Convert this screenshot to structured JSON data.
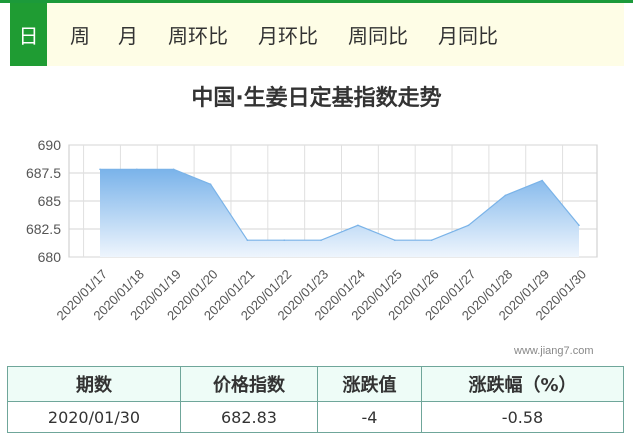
{
  "tabs": [
    {
      "label": "日",
      "active": true
    },
    {
      "label": "周",
      "active": false
    },
    {
      "label": "月",
      "active": false
    },
    {
      "label": "周环比",
      "active": false
    },
    {
      "label": "月环比",
      "active": false
    },
    {
      "label": "周同比",
      "active": false
    },
    {
      "label": "月同比",
      "active": false
    }
  ],
  "chart_title": "中国·生姜日定基指数走势",
  "watermark": "www.jiang7.com",
  "colors": {
    "accent": "#1f9c33",
    "line": "#7ab3e8",
    "fill_top": "#7ab3ea",
    "fill_bottom": "#eef5fd",
    "tab_bg": "#fefde6"
  },
  "chart_data": {
    "type": "area",
    "title": "中国·生姜日定基指数走势",
    "xlabel": "",
    "ylabel": "",
    "categories": [
      "2020/01/17",
      "2020/01/18",
      "2020/01/19",
      "2020/01/20",
      "2020/01/21",
      "2020/01/22",
      "2020/01/23",
      "2020/01/24",
      "2020/01/25",
      "2020/01/26",
      "2020/01/27",
      "2020/01/28",
      "2020/01/29",
      "2020/01/30"
    ],
    "values": [
      687.83,
      687.83,
      687.83,
      686.5,
      681.5,
      681.5,
      681.5,
      682.83,
      681.5,
      681.5,
      682.83,
      685.5,
      686.83,
      682.83
    ],
    "ylim": [
      680,
      690
    ],
    "yticks": [
      "690",
      "687.5",
      "685",
      "682.5",
      "680"
    ],
    "ytick_values": [
      690,
      687.5,
      685,
      682.5,
      680
    ],
    "grid": true
  },
  "table": {
    "headers": [
      "期数",
      "价格指数",
      "涨跌值",
      "涨跌幅（%）"
    ],
    "rows": [
      [
        "2020/01/30",
        "682.83",
        "-4",
        "-0.58"
      ]
    ]
  }
}
